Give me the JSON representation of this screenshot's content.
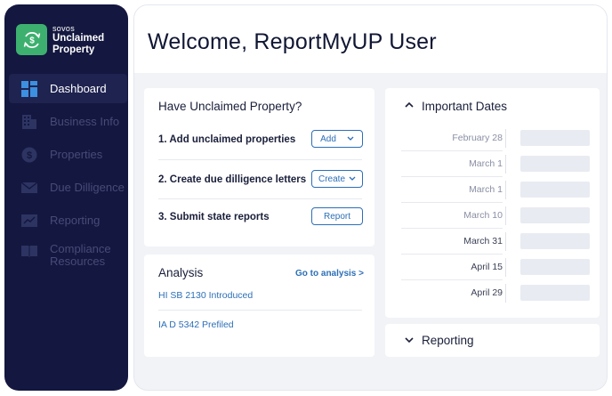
{
  "sidebar": {
    "brand_sub": "sovos",
    "brand_title_1": "Unclaimed",
    "brand_title_2": "Property",
    "items": [
      {
        "label": "Dashboard",
        "icon": "dashboard-icon",
        "active": true
      },
      {
        "label": "Business Info",
        "icon": "building-icon",
        "active": false
      },
      {
        "label": "Properties",
        "icon": "dollar-coin-icon",
        "active": false
      },
      {
        "label": "Due Dilligence",
        "icon": "envelope-icon",
        "active": false
      },
      {
        "label": "Reporting",
        "icon": "chart-icon",
        "active": false
      },
      {
        "label": "Compliance",
        "label2": "Resources",
        "icon": "book-icon",
        "active": false
      }
    ]
  },
  "header": {
    "title": "Welcome, ReportMyUP User"
  },
  "unclaimed": {
    "title": "Have Unclaimed Property?",
    "steps": [
      {
        "label": "1.  Add unclaimed properties",
        "button": "Add"
      },
      {
        "label": "2.  Create due dilligence letters",
        "button": "Create"
      },
      {
        "label": "3.  Submit state reports",
        "button": "Report"
      }
    ]
  },
  "analysis": {
    "title": "Analysis",
    "go_link": "Go to analysis >",
    "items": [
      "HI SB 2130 Introduced",
      "IA D 5342 Prefiled"
    ]
  },
  "important_dates": {
    "title": "Important Dates",
    "dates": [
      "February 28",
      "March 1",
      "March 1",
      "March 10",
      "March 31",
      "April 15",
      "April 29"
    ]
  },
  "reporting": {
    "title": "Reporting"
  },
  "colors": {
    "sidebar": "#14173f",
    "accent": "#2c6fb7",
    "logo": "#3db06f"
  }
}
